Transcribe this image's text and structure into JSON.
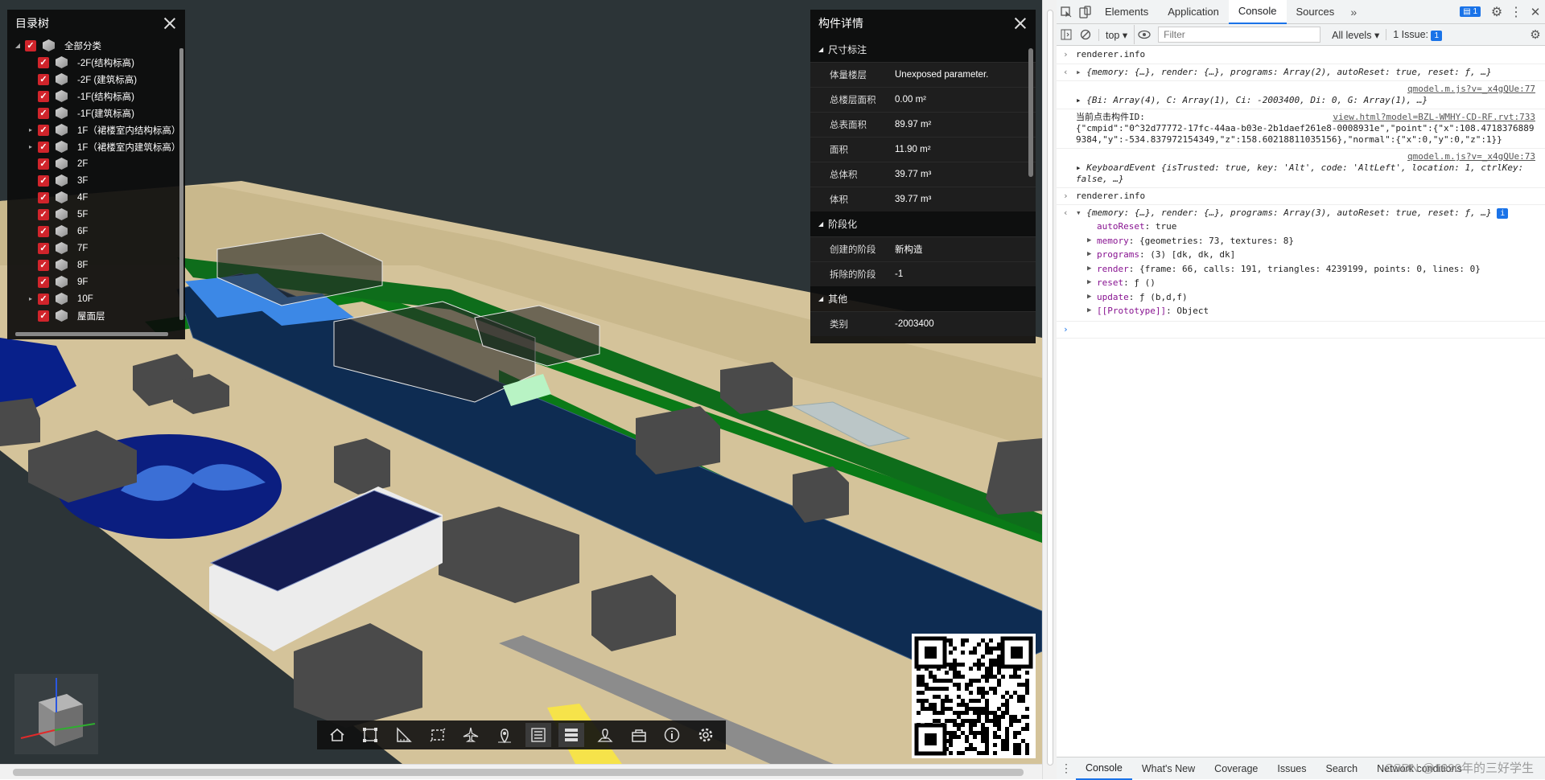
{
  "tree": {
    "title": "目录树",
    "items": [
      {
        "label": "全部分类",
        "level": 0
      },
      {
        "label": "-2F(结构标高)",
        "level": 1
      },
      {
        "label": "-2F (建筑标高)",
        "level": 1
      },
      {
        "label": "-1F(结构标高)",
        "level": 1
      },
      {
        "label": "-1F(建筑标高)",
        "level": 1
      },
      {
        "label": "1F（裙楼室内结构标高）",
        "level": 1
      },
      {
        "label": "1F（裙楼室内建筑标高）",
        "level": 1
      },
      {
        "label": "2F",
        "level": 1
      },
      {
        "label": "3F",
        "level": 1
      },
      {
        "label": "4F",
        "level": 1
      },
      {
        "label": "5F",
        "level": 1
      },
      {
        "label": "6F",
        "level": 1
      },
      {
        "label": "7F",
        "level": 1
      },
      {
        "label": "8F",
        "level": 1
      },
      {
        "label": "9F",
        "level": 1
      },
      {
        "label": "10F",
        "level": 1
      },
      {
        "label": "屋面层",
        "level": 1
      }
    ]
  },
  "props": {
    "title": "构件详情",
    "sections": [
      {
        "name": "尺寸标注",
        "rows": [
          {
            "k": "体量楼层",
            "v": "Unexposed parameter."
          },
          {
            "k": "总楼层面积",
            "v": "0.00 m²"
          },
          {
            "k": "总表面积",
            "v": "89.97 m²"
          },
          {
            "k": "面积",
            "v": "11.90 m²"
          },
          {
            "k": "总体积",
            "v": "39.77 m³"
          },
          {
            "k": "体积",
            "v": "39.77 m³"
          }
        ]
      },
      {
        "name": "阶段化",
        "rows": [
          {
            "k": "创建的阶段",
            "v": "新构造"
          },
          {
            "k": "拆除的阶段",
            "v": "-1"
          }
        ]
      },
      {
        "name": "其他",
        "rows": [
          {
            "k": "类别",
            "v": "-2003400"
          }
        ]
      }
    ]
  },
  "toolbar": {
    "buttons": [
      {
        "name": "home-icon"
      },
      {
        "name": "fit-view-icon"
      },
      {
        "name": "measure-icon"
      },
      {
        "name": "section-box-icon"
      },
      {
        "name": "roam-plane-icon"
      },
      {
        "name": "location-pin-icon"
      },
      {
        "name": "model-tree-icon"
      },
      {
        "name": "properties-icon"
      },
      {
        "name": "map-marker-icon"
      },
      {
        "name": "toolbox-icon"
      },
      {
        "name": "info-icon"
      },
      {
        "name": "settings-icon"
      }
    ]
  },
  "devtools": {
    "tabs": [
      "Elements",
      "Application",
      "Console",
      "Sources"
    ],
    "active_tab": "Console",
    "msg_count": "1",
    "context": "top",
    "filter_placeholder": "Filter",
    "levels": "All levels",
    "issues": "1 Issue:",
    "issues_count": "1",
    "console": {
      "cmd1": "renderer.info",
      "res1": "{memory: {…}, render: {…}, programs: Array(2), autoReset: true, reset: ƒ, …}",
      "src2": "qmodel.m.js?v=_x4gQUe:77",
      "log2": "{Bi: Array(4), C: Array(1), Ci: -2003400, Di: 0, G: Array(1), …}",
      "src3": "view.html?model=BZL-WMHY-CD-RF.rvt:733",
      "log3_label": "当前点击构件ID:",
      "log3_body": "{\"cmpid\":\"0^32d77772-17fc-44aa-b03e-2b1daef261e8-0008931e\",\"point\":{\"x\":108.47183768899384,\"y\":-534.837972154349,\"z\":158.60218811035156},\"normal\":{\"x\":0,\"y\":0,\"z\":1}}",
      "src4": "qmodel.m.js?v=_x4gQUe:73",
      "log4": "KeyboardEvent {isTrusted: true, key: 'Alt', code: 'AltLeft', location: 1, ctrlKey: false, …}",
      "cmd5": "renderer.info",
      "res5": "{memory: {…}, render: {…}, programs: Array(3), autoReset: true, reset: ƒ, …}",
      "props5": [
        {
          "k": "autoReset",
          "v": "true",
          "expand": false
        },
        {
          "k": "memory",
          "v": "{geometries: 73, textures: 8}",
          "expand": true
        },
        {
          "k": "programs",
          "v": "(3) [dk, dk, dk]",
          "expand": true
        },
        {
          "k": "render",
          "v": "{frame: 66, calls: 191, triangles: 4239199, points: 0, lines: 0}",
          "expand": true
        },
        {
          "k": "reset",
          "v": "ƒ ()",
          "expand": true
        },
        {
          "k": "update",
          "v": "ƒ (b,d,f)",
          "expand": true
        },
        {
          "k": "[[Prototype]]",
          "v": "Object",
          "expand": true
        }
      ]
    },
    "drawer_tabs": [
      "Console",
      "What's New",
      "Coverage",
      "Issues",
      "Search",
      "Network conditions"
    ],
    "watermark": "CSDN @1990年的三好学生"
  }
}
